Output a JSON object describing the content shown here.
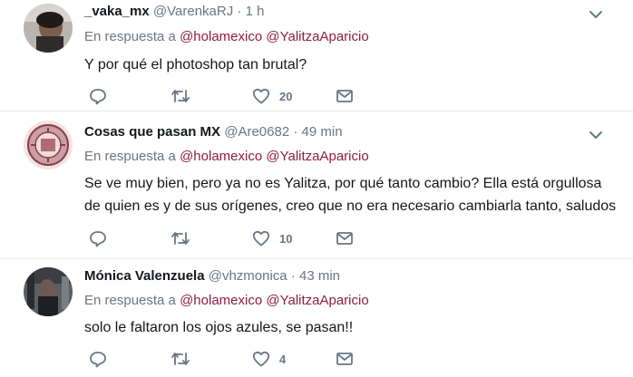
{
  "tweets": [
    {
      "name": "_vaka_mx",
      "handle": "@VarenkaRJ",
      "dot": "·",
      "time": "1 h",
      "reply_prefix": "En respuesta a",
      "mentions": [
        "@holamexico",
        "@YalitzaAparicio"
      ],
      "text": "Y por qué el photoshop tan brutal?",
      "likes": "20"
    },
    {
      "name": "Cosas que pasan MX",
      "handle": "@Are0682",
      "dot": "·",
      "time": "49 min",
      "reply_prefix": "En respuesta a",
      "mentions": [
        "@holamexico",
        "@YalitzaAparicio"
      ],
      "text_lines": [
        "Se ve muy bien, pero ya no es Yalitza, por qué tanto cambio? Ella está orgullosa",
        "de quien es y de sus orígenes, creo que no era necesario cambiarla tanto, saludos"
      ],
      "likes": "10"
    },
    {
      "name": "Mónica Valenzuela",
      "handle": "@vhzmonica",
      "dot": "·",
      "time": "43 min",
      "reply_prefix": "En respuesta a",
      "mentions": [
        "@holamexico",
        "@YalitzaAparicio"
      ],
      "text": "solo le faltaron los ojos azules, se pasan!!",
      "likes": "4"
    }
  ],
  "colors": {
    "mention": "#8e1d45",
    "muted": "#657786",
    "text": "#14171a",
    "divider": "#e6ecf0"
  },
  "icons": [
    "reply-icon",
    "retweet-icon",
    "like-icon",
    "message-icon",
    "chevron-down-icon"
  ]
}
